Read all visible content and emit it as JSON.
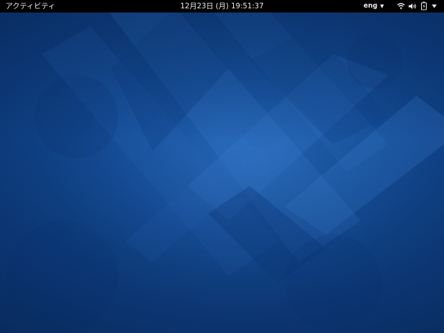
{
  "topbar": {
    "activities_label": "アクティビティ",
    "clock_text": "12月23日 (月) 19:51:37",
    "input_source": "eng",
    "status_icons": [
      "wifi-icon",
      "volume-icon",
      "battery-icon",
      "system-menu-arrow-icon"
    ]
  },
  "desktop": {
    "wallpaper": "blue-geometric-wallpaper"
  },
  "colors": {
    "topbar_bg": "#000000",
    "topbar_text": "#eeeeec",
    "wallpaper_base": "#134a93",
    "wallpaper_highlight": "#2a6bbd",
    "wallpaper_shadow": "#0a2f66"
  }
}
